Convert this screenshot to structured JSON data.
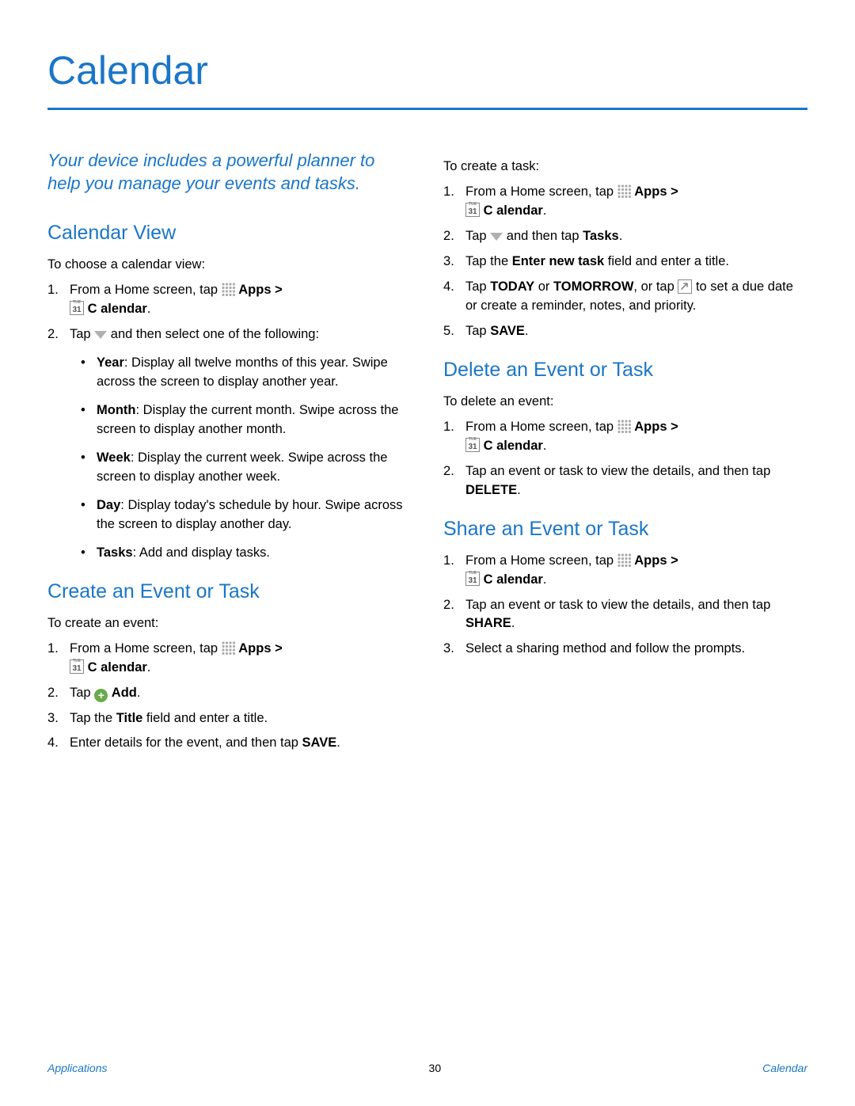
{
  "page_title": "Calendar",
  "intro": "Your device includes a powerful planner to help you manage your events and tasks.",
  "icons": {
    "apps": "apps-grid-icon",
    "calendar": "calendar-31-icon",
    "dropdown": "dropdown-triangle-icon",
    "add": "add-plus-circle-icon",
    "expand": "expand-arrow-box-icon"
  },
  "labels": {
    "apps": "Apps",
    "calendar": "C alendar",
    "add": "Add",
    "tasks": "Tasks",
    "save": "SAVE",
    "delete": "DELETE",
    "share": "SHARE",
    "today": "TODAY",
    "tomorrow": "TOMORROW",
    "enter_new_task": "Enter new task",
    "title_field": "Title",
    "gt": " > "
  },
  "sections": {
    "calendar_view": {
      "heading": "Calendar View",
      "lead": "To choose a calendar view:",
      "step1a": "From a Home screen, tap ",
      "step2a": "Tap ",
      "step2b": " and then select one of the following:",
      "views": [
        {
          "name": "Year",
          "desc": ": Display all twelve months of this year. Swipe across the screen to display another year."
        },
        {
          "name": "Month",
          "desc": ": Display the current month. Swipe across the screen to display another month."
        },
        {
          "name": "Week",
          "desc": ": Display the current week. Swipe across the screen to display another week."
        },
        {
          "name": "Day",
          "desc": ": Display today's schedule by hour. Swipe across the screen to display another day."
        },
        {
          "name": "Tasks",
          "desc": ": Add and display tasks."
        }
      ]
    },
    "create": {
      "heading": "Create an Event or Task",
      "event_lead": "To create an event:",
      "event_step1a": "From a Home screen, tap ",
      "event_step2a": "Tap ",
      "event_step3a": "Tap the ",
      "event_step3b": " field and enter a title.",
      "event_step4": "Enter details for the event, and then tap ",
      "task_lead": "To create a task:",
      "task_step1a": "From a Home screen, tap ",
      "task_step2a": "Tap ",
      "task_step2b": " and then tap ",
      "task_step3a": "Tap the ",
      "task_step3b": " field and enter a title.",
      "task_step4a": "Tap ",
      "task_step4b": " or ",
      "task_step4c": ", or tap ",
      "task_step4d": " to set a due date or create a reminder, notes, and priority.",
      "task_step5a": "Tap "
    },
    "delete": {
      "heading": "Delete an Event or Task",
      "lead": "To delete an event:",
      "step1a": "From a Home screen, tap ",
      "step2": "Tap an event or task to view the details, and then tap "
    },
    "share": {
      "heading": "Share an Event or Task",
      "step1a": "From a Home screen, tap ",
      "step2": "Tap an event or task to view the details, and then tap ",
      "step3": "Select a sharing method and follow the prompts."
    }
  },
  "footer": {
    "left": "Applications",
    "center": "30",
    "right": "Calendar"
  }
}
